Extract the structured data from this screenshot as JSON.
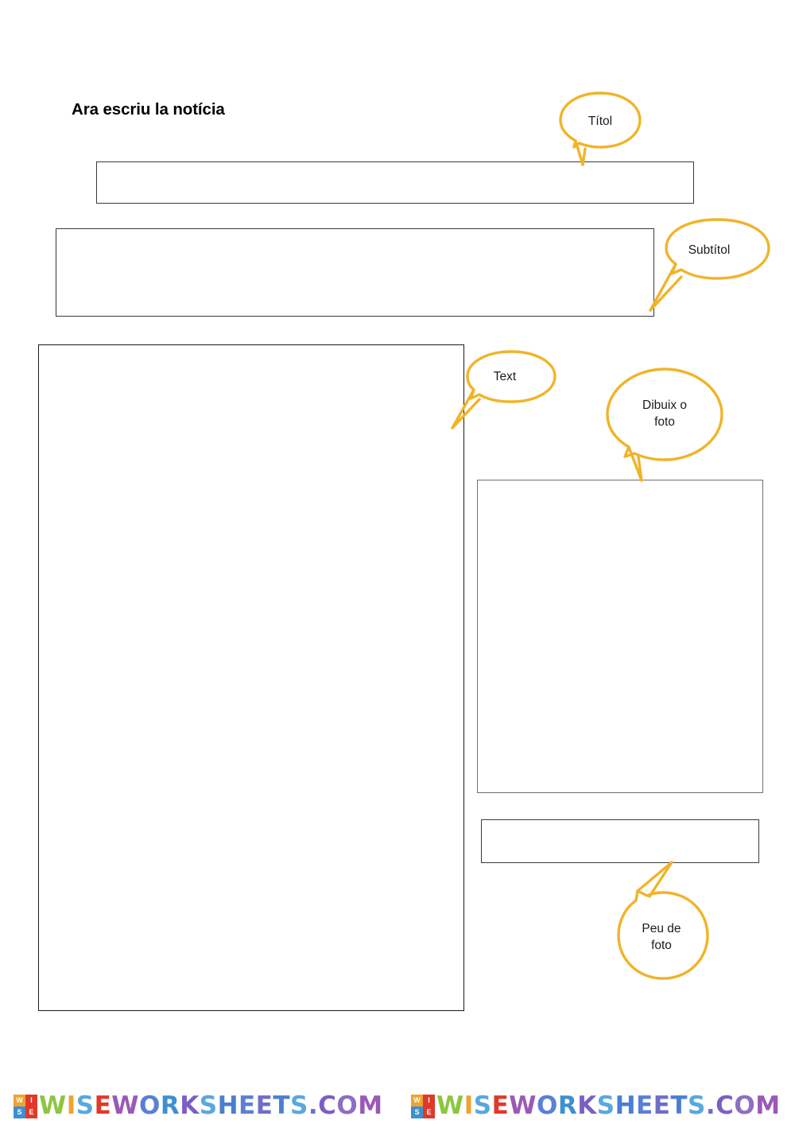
{
  "page": {
    "title": "Ara escriu la notícia",
    "language": "ca",
    "background_color": "#ffffff",
    "accent_color": "#f0b429",
    "border_color": "#3a3a3a"
  },
  "fields": [
    {
      "id": "title-box",
      "name": "titol-field",
      "value": "",
      "placeholder": "",
      "callout": "Títol"
    },
    {
      "id": "subtitle-box",
      "name": "subtitol-field",
      "value": "",
      "placeholder": "",
      "callout": "Subtítol"
    },
    {
      "id": "text-box",
      "name": "text-field",
      "value": "",
      "placeholder": "",
      "callout": "Text"
    },
    {
      "id": "image-box",
      "name": "dibuix-o-foto-field",
      "value": "",
      "placeholder": "",
      "callout": "Dibuix o foto"
    },
    {
      "id": "caption-box",
      "name": "peu-de-foto-field",
      "value": "",
      "placeholder": "",
      "callout": "Peu de foto"
    }
  ],
  "callouts": {
    "titol": {
      "label": "Títol",
      "color": "#f0b429"
    },
    "subtitol": {
      "label": "Subtítol",
      "color": "#f0b429"
    },
    "text": {
      "label": "Text",
      "color": "#f0b429"
    },
    "dibuix": {
      "line1": "Dibuix o",
      "line2": "foto",
      "color": "#f0b429"
    },
    "peu": {
      "line1": "Peu de",
      "line2": "foto",
      "color": "#f0b429"
    }
  },
  "watermark": {
    "text": "WISEWORKSHEETS.COM",
    "logo_letters": [
      "W",
      "I",
      "S",
      "E"
    ],
    "logo_colors": [
      "#f0a22e",
      "#e0392b",
      "#3e8fd0",
      "#e0392b"
    ],
    "repeat": 2,
    "letter_colors": [
      "#8dc63f",
      "#f0a22e",
      "#5aa8dd",
      "#e0392b",
      "#9b59b6",
      "#5b7fd4",
      "#3e8fd0",
      "#7b5fc4",
      "#5aa8dd",
      "#4a7fd0",
      "#5b7fd4",
      "#6d6ec8",
      "#4a7fd0",
      "#5aa8dd",
      "#6d6ec8",
      "#7b5fc4",
      "#8e6fc0",
      "#9b59b6",
      "#8e6fc0",
      "#7b5fc4",
      "#6d6ec8",
      "#8e6fc0"
    ]
  }
}
